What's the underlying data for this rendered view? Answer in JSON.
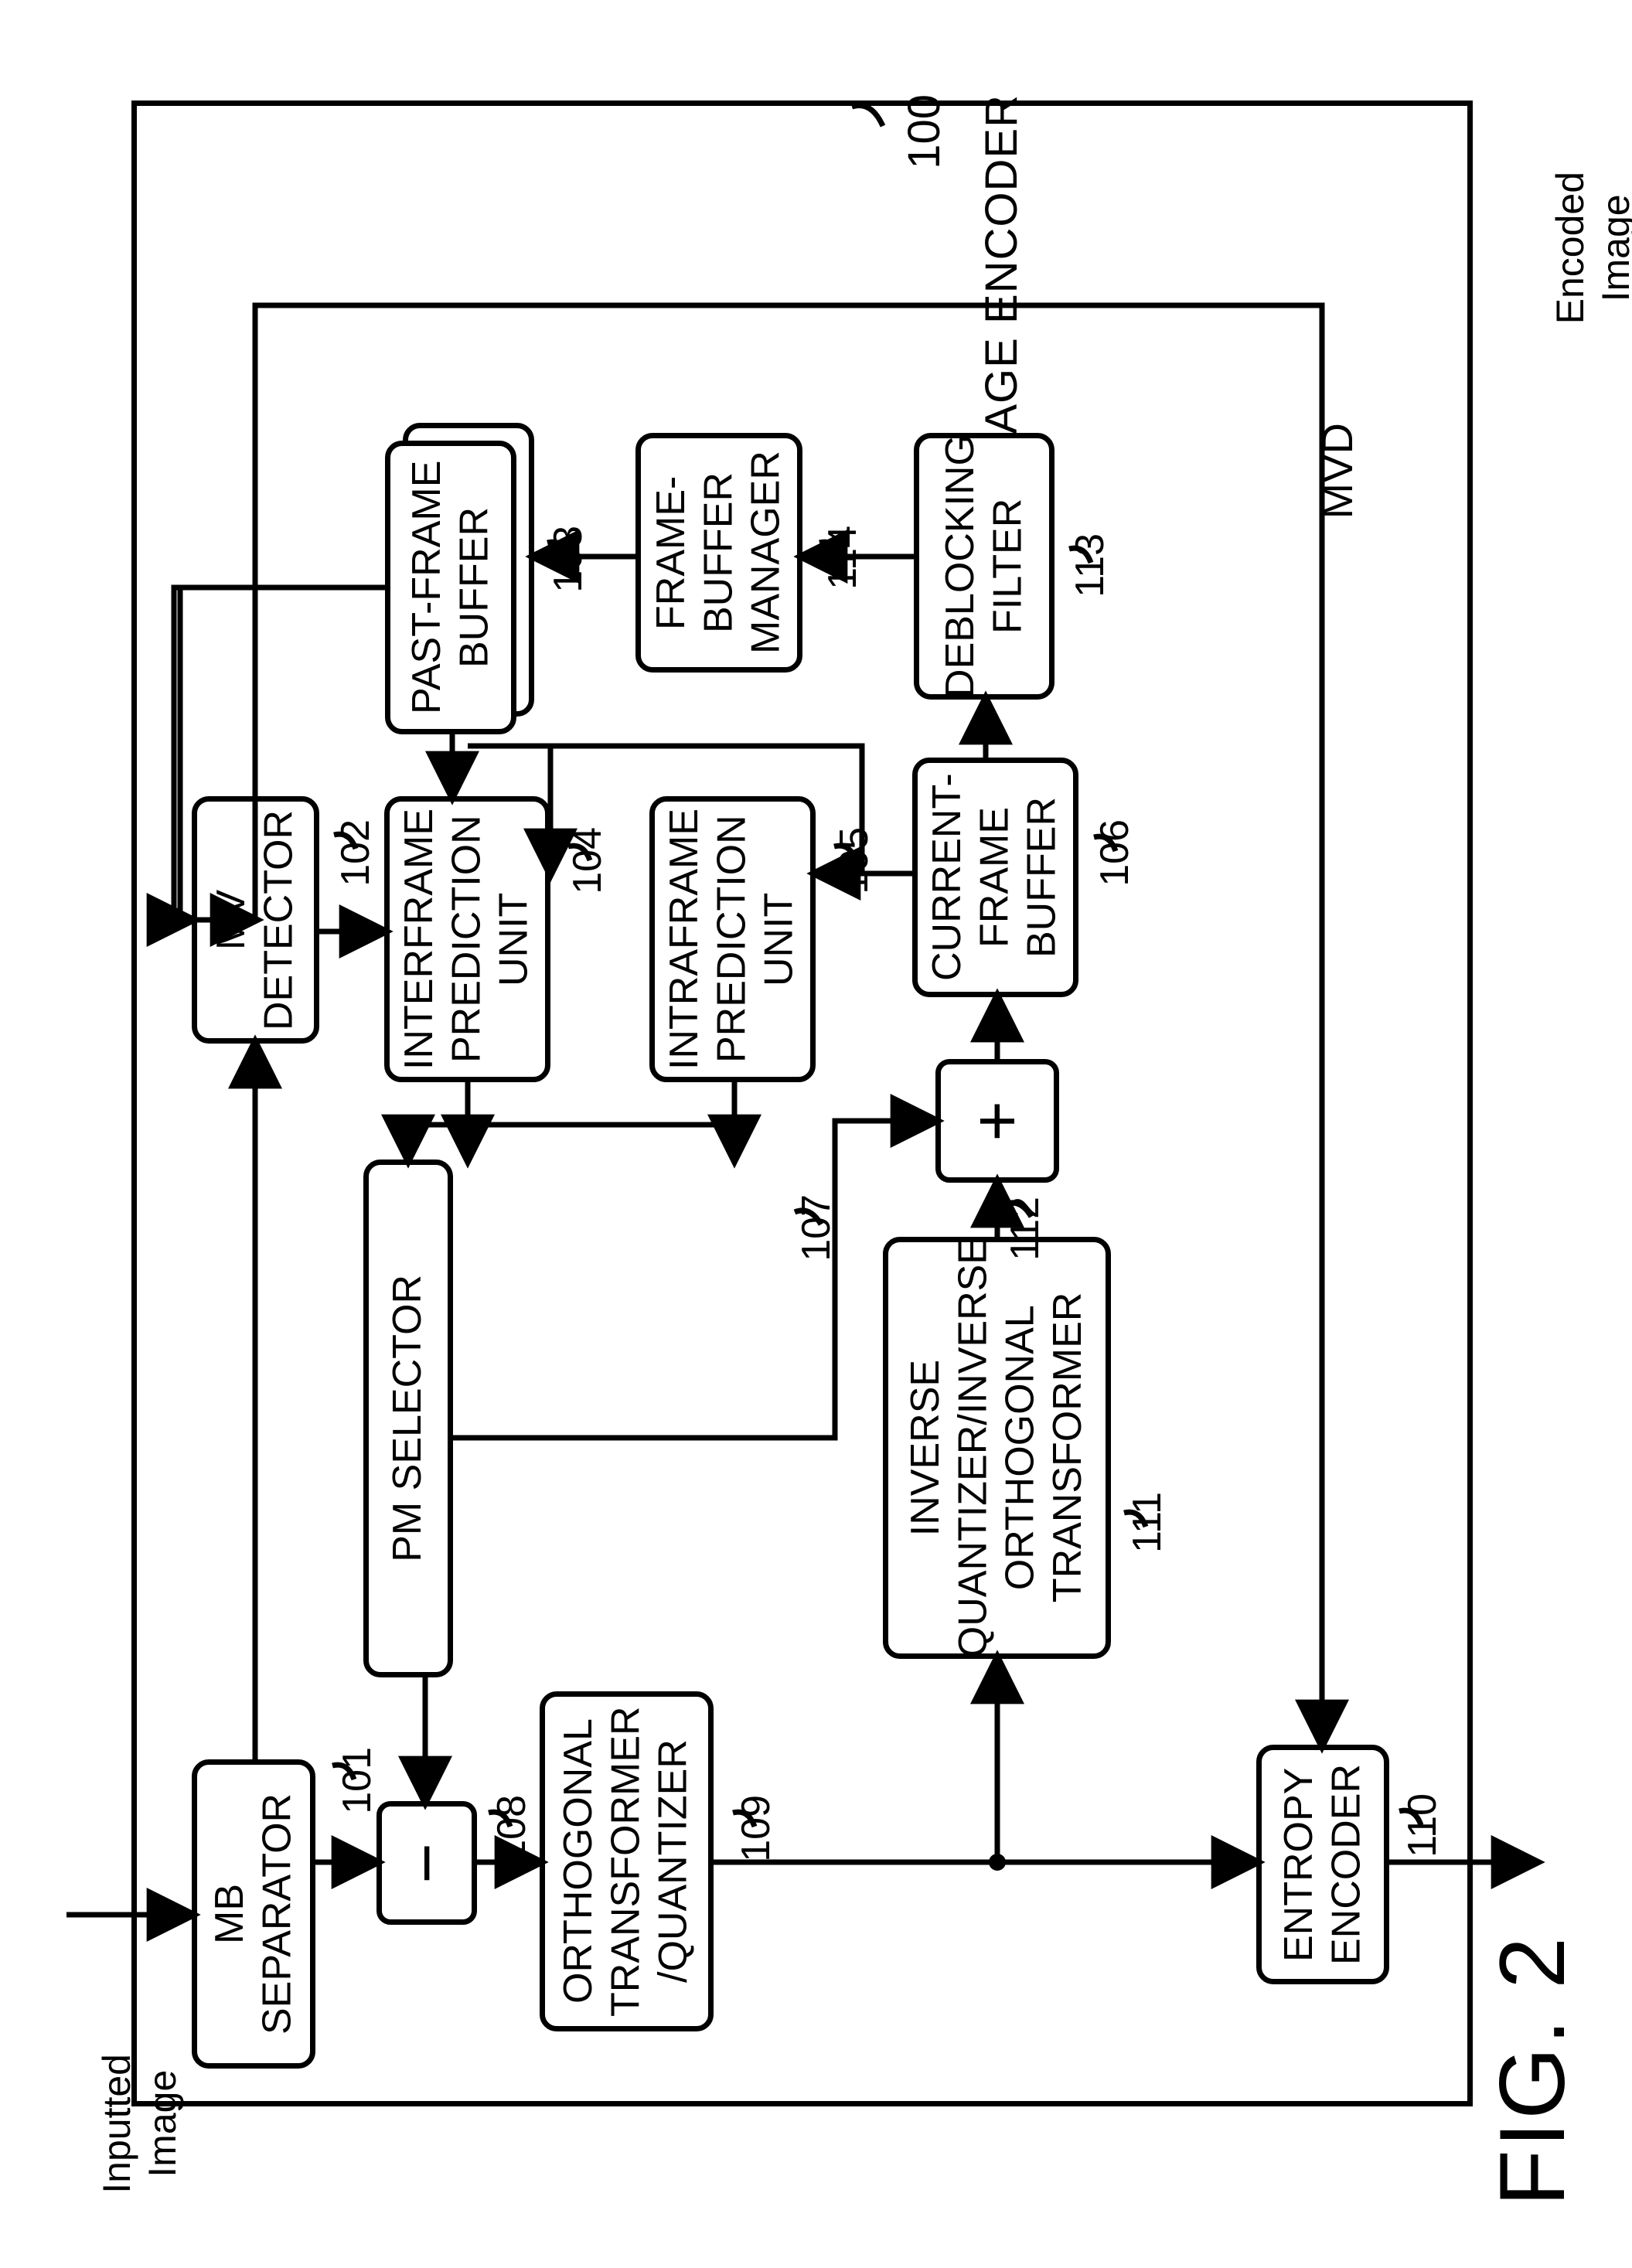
{
  "figure_label": "FIG. 2",
  "io": {
    "input": "Inputted\nImage",
    "output": "Encoded\nImage"
  },
  "container": {
    "ref": "100",
    "title": "IMAGE ENCODER"
  },
  "blocks": {
    "b101": {
      "ref": "101",
      "label": "MB\nSEPARATOR"
    },
    "b102": {
      "ref": "102",
      "label": "MV\nDETECTOR"
    },
    "b103": {
      "ref": "103",
      "label": "PAST-FRAME\nBUFFER"
    },
    "b104": {
      "ref": "104",
      "label": "INTERFRAME\nPREDICTION\nUNIT"
    },
    "b105": {
      "ref": "105",
      "label": "INTRAFRAME\nPREDICTION\nUNIT"
    },
    "b106": {
      "ref": "106",
      "label": "CURRENT-\nFRAME\nBUFFER"
    },
    "b107": {
      "ref": "107",
      "label": "PM SELECTOR"
    },
    "b108": {
      "ref": "108",
      "label": "−"
    },
    "b109": {
      "ref": "109",
      "label": "ORTHOGONAL\nTRANSFORMER\n/QUANTIZER"
    },
    "b110": {
      "ref": "110",
      "label": "ENTROPY\nENCODER"
    },
    "b111": {
      "ref": "111",
      "label": "INVERSE\nQUANTIZER/INVERSE\nORTHOGONAL\nTRANSFORMER"
    },
    "b112": {
      "ref": "112",
      "label": "+"
    },
    "b113": {
      "ref": "113",
      "label": "DEBLOCKING\nFILTER"
    },
    "b114": {
      "ref": "114",
      "label": "FRAME-\nBUFFER\nMANAGER"
    }
  },
  "mvd": "MVD"
}
